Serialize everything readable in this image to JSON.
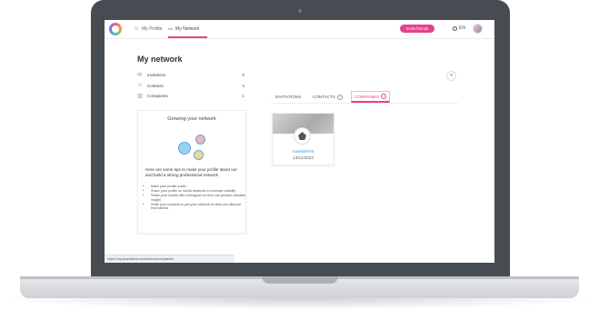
{
  "nav": {
    "my_profile": "My Profile",
    "my_network": "My Network",
    "invite": "Invite friends",
    "lang": "EN"
  },
  "page": {
    "title": "My network"
  },
  "stats": [
    {
      "label": "Invitations",
      "count": "0",
      "icon": "envelope-icon"
    },
    {
      "label": "Contacts",
      "count": "0",
      "icon": "contacts-icon"
    },
    {
      "label": "Companies",
      "count": "1",
      "icon": "building-icon"
    }
  ],
  "tips": {
    "title": "Growing your network",
    "lead": "Here are some tips to make your profile stand out and build a strong professional network",
    "items": [
      "Make your profile public",
      "Share your profile on social networks to increase visibility",
      "Share your results with colleagues so they can provide valuable insight",
      "Invite your contacts to join your network so they can discover their talents"
    ]
  },
  "tabs": [
    {
      "label": "INVITATIONS",
      "active": false
    },
    {
      "label": "CONTACTS",
      "active": false
    },
    {
      "label": "COMPANIES",
      "active": true
    }
  ],
  "company": {
    "name": "AssessFirst",
    "date": "13/11/2023"
  },
  "status_url": "https://my.assessfirst.com/network/companies",
  "colors": {
    "accent": "#e6418a",
    "link": "#3a8fd6"
  }
}
